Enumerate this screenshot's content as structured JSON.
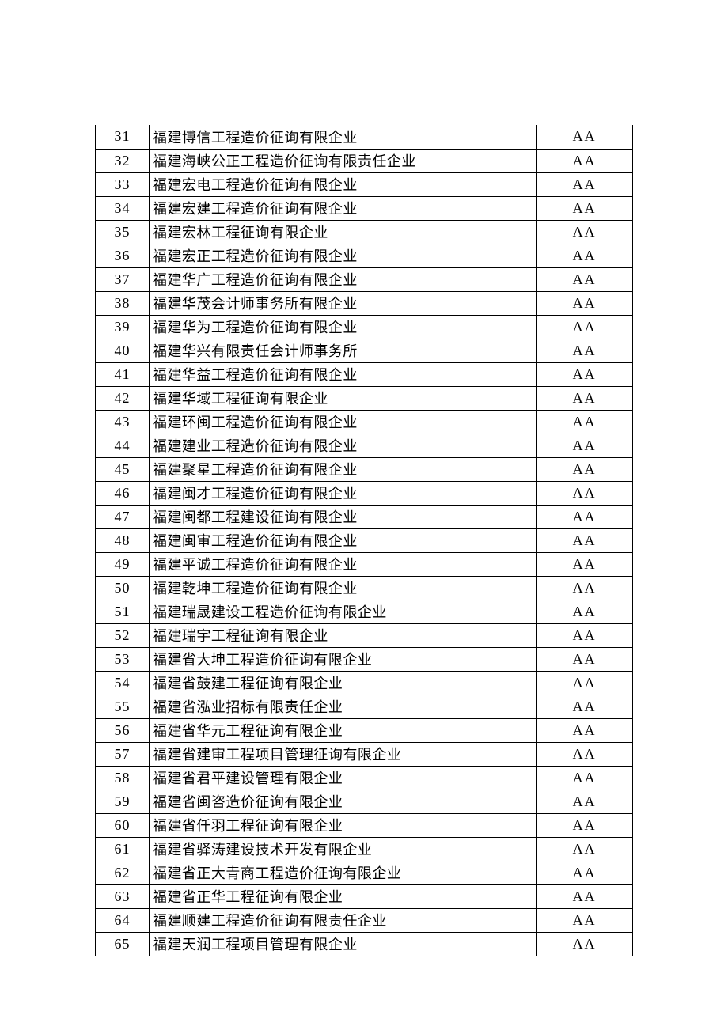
{
  "table": {
    "rows": [
      {
        "num": "31",
        "name": "福建博信工程造价征询有限企业",
        "rating": "AA"
      },
      {
        "num": "32",
        "name": "福建海峡公正工程造价征询有限责任企业",
        "rating": "AA"
      },
      {
        "num": "33",
        "name": "福建宏电工程造价征询有限企业",
        "rating": "AA"
      },
      {
        "num": "34",
        "name": "福建宏建工程造价征询有限企业",
        "rating": "AA"
      },
      {
        "num": "35",
        "name": "福建宏林工程征询有限企业",
        "rating": "AA"
      },
      {
        "num": "36",
        "name": "福建宏正工程造价征询有限企业",
        "rating": "AA"
      },
      {
        "num": "37",
        "name": "福建华广工程造价征询有限企业",
        "rating": "AA"
      },
      {
        "num": "38",
        "name": "福建华茂会计师事务所有限企业",
        "rating": "AA"
      },
      {
        "num": "39",
        "name": "福建华为工程造价征询有限企业",
        "rating": "AA"
      },
      {
        "num": "40",
        "name": "福建华兴有限责任会计师事务所",
        "rating": "AA"
      },
      {
        "num": "41",
        "name": "福建华益工程造价征询有限企业",
        "rating": "AA"
      },
      {
        "num": "42",
        "name": "福建华域工程征询有限企业",
        "rating": "AA"
      },
      {
        "num": "43",
        "name": "福建环闽工程造价征询有限企业",
        "rating": "AA"
      },
      {
        "num": "44",
        "name": "福建建业工程造价征询有限企业",
        "rating": "AA"
      },
      {
        "num": "45",
        "name": "福建聚星工程造价征询有限企业",
        "rating": "AA"
      },
      {
        "num": "46",
        "name": "福建闽才工程造价征询有限企业",
        "rating": "AA"
      },
      {
        "num": "47",
        "name": "福建闽都工程建设征询有限企业",
        "rating": "AA"
      },
      {
        "num": "48",
        "name": "福建闽审工程造价征询有限企业",
        "rating": "AA"
      },
      {
        "num": "49",
        "name": "福建平诚工程造价征询有限企业",
        "rating": "AA"
      },
      {
        "num": "50",
        "name": "福建乾坤工程造价征询有限企业",
        "rating": "AA"
      },
      {
        "num": "51",
        "name": "福建瑞晟建设工程造价征询有限企业",
        "rating": "AA"
      },
      {
        "num": "52",
        "name": "福建瑞宇工程征询有限企业",
        "rating": "AA"
      },
      {
        "num": "53",
        "name": "福建省大坤工程造价征询有限企业",
        "rating": "AA"
      },
      {
        "num": "54",
        "name": "福建省鼓建工程征询有限企业",
        "rating": "AA"
      },
      {
        "num": "55",
        "name": "福建省泓业招标有限责任企业",
        "rating": "AA"
      },
      {
        "num": "56",
        "name": "福建省华元工程征询有限企业",
        "rating": "AA"
      },
      {
        "num": "57",
        "name": "福建省建审工程项目管理征询有限企业",
        "rating": "AA"
      },
      {
        "num": "58",
        "name": "福建省君平建设管理有限企业",
        "rating": "AA"
      },
      {
        "num": "59",
        "name": "福建省闽咨造价征询有限企业",
        "rating": "AA"
      },
      {
        "num": "60",
        "name": "福建省仟羽工程征询有限企业",
        "rating": "AA"
      },
      {
        "num": "61",
        "name": "福建省驿涛建设技术开发有限企业",
        "rating": "AA"
      },
      {
        "num": "62",
        "name": "福建省正大青商工程造价征询有限企业",
        "rating": "AA"
      },
      {
        "num": "63",
        "name": "福建省正华工程征询有限企业",
        "rating": "AA"
      },
      {
        "num": "64",
        "name": "福建顺建工程造价征询有限责任企业",
        "rating": "AA"
      },
      {
        "num": "65",
        "name": "福建天润工程项目管理有限企业",
        "rating": "AA"
      }
    ]
  }
}
